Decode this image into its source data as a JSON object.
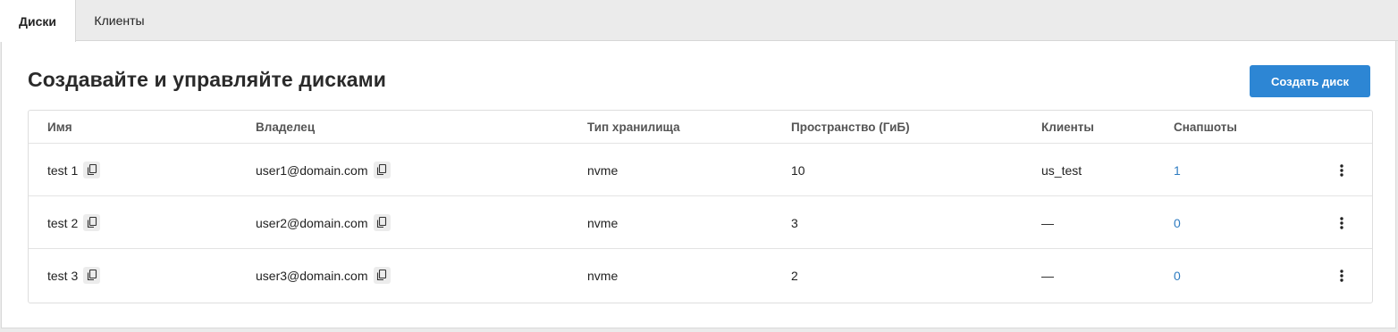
{
  "tabs": [
    {
      "label": "Диски",
      "active": true
    },
    {
      "label": "Клиенты",
      "active": false
    }
  ],
  "page": {
    "title": "Создавайте и управляйте дисками",
    "create_button": "Создать диск"
  },
  "table": {
    "columns": [
      "Имя",
      "Владелец",
      "Тип хранилища",
      "Пространство (ГиБ)",
      "Клиенты",
      "Снапшоты"
    ],
    "rows": [
      {
        "name": "test 1",
        "owner": "user1@domain.com",
        "type": "nvme",
        "space": "10",
        "clients": "us_test",
        "snapshots": "1"
      },
      {
        "name": "test 2",
        "owner": "user2@domain.com",
        "type": "nvme",
        "space": "3",
        "clients": "—",
        "snapshots": "0"
      },
      {
        "name": "test 3",
        "owner": "user3@domain.com",
        "type": "nvme",
        "space": "2",
        "clients": "—",
        "snapshots": "0"
      }
    ]
  },
  "icons": {
    "copy": "copy-icon",
    "menu": "kebab-menu-icon"
  },
  "colors": {
    "accent": "#2d86d4",
    "link": "#2f7cc1"
  }
}
